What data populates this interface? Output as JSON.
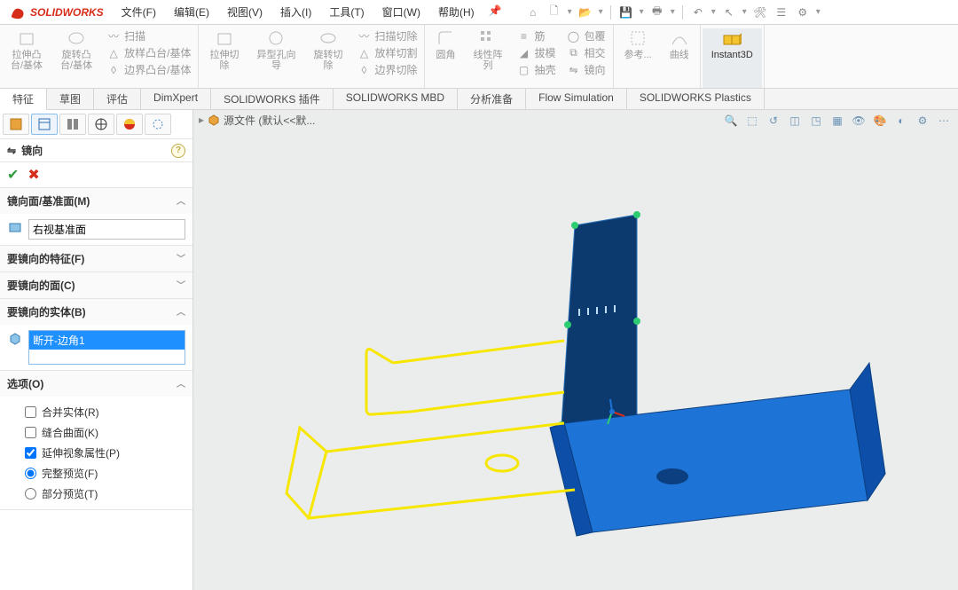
{
  "app": {
    "name": "SOLIDWORKS"
  },
  "menu": {
    "items": [
      "文件(F)",
      "编辑(E)",
      "视图(V)",
      "插入(I)",
      "工具(T)",
      "窗口(W)",
      "帮助(H)"
    ]
  },
  "toolbar": {
    "extrude": "拉伸凸\n台/基体",
    "revolve": "旋转凸\n台/基体",
    "sweep": "扫描",
    "loft": "放样凸台/基体",
    "boundary": "边界凸台/基体",
    "cut_extrude": "拉伸切\n除",
    "hole": "异型孔向\n导",
    "cut_revolve": "旋转切\n除",
    "cut_sweep": "扫描切除",
    "cut_loft": "放样切割",
    "cut_boundary": "边界切除",
    "fillet": "圆角",
    "pattern": "线性阵\n列",
    "rib": "筋",
    "draft": "拔模",
    "shell": "抽壳",
    "wrap": "包覆",
    "intersect": "相交",
    "mirror": "镜向",
    "ref": "参考...",
    "curves": "曲线",
    "instant3d": "Instant3D"
  },
  "tabs": {
    "items": [
      "特征",
      "草图",
      "评估",
      "DimXpert",
      "SOLIDWORKS 插件",
      "SOLIDWORKS MBD",
      "分析准备",
      "Flow Simulation",
      "SOLIDWORKS Plastics"
    ],
    "active": 0
  },
  "breadcrumb": {
    "file": "源文件  (默认<<默..."
  },
  "pm": {
    "title": "镜向",
    "sec_plane": "镜向面/基准面(M)",
    "plane_value": "右视基准面",
    "sec_features": "要镜向的特征(F)",
    "sec_faces": "要镜向的面(C)",
    "sec_bodies": "要镜向的实体(B)",
    "body_sel": "断开-边角1",
    "sec_options": "选项(O)",
    "opt_merge": "合并实体(R)",
    "opt_knit": "缝合曲面(K)",
    "opt_propagate": "延伸视象属性(P)",
    "opt_full": "完整预览(F)",
    "opt_partial": "部分预览(T)"
  }
}
